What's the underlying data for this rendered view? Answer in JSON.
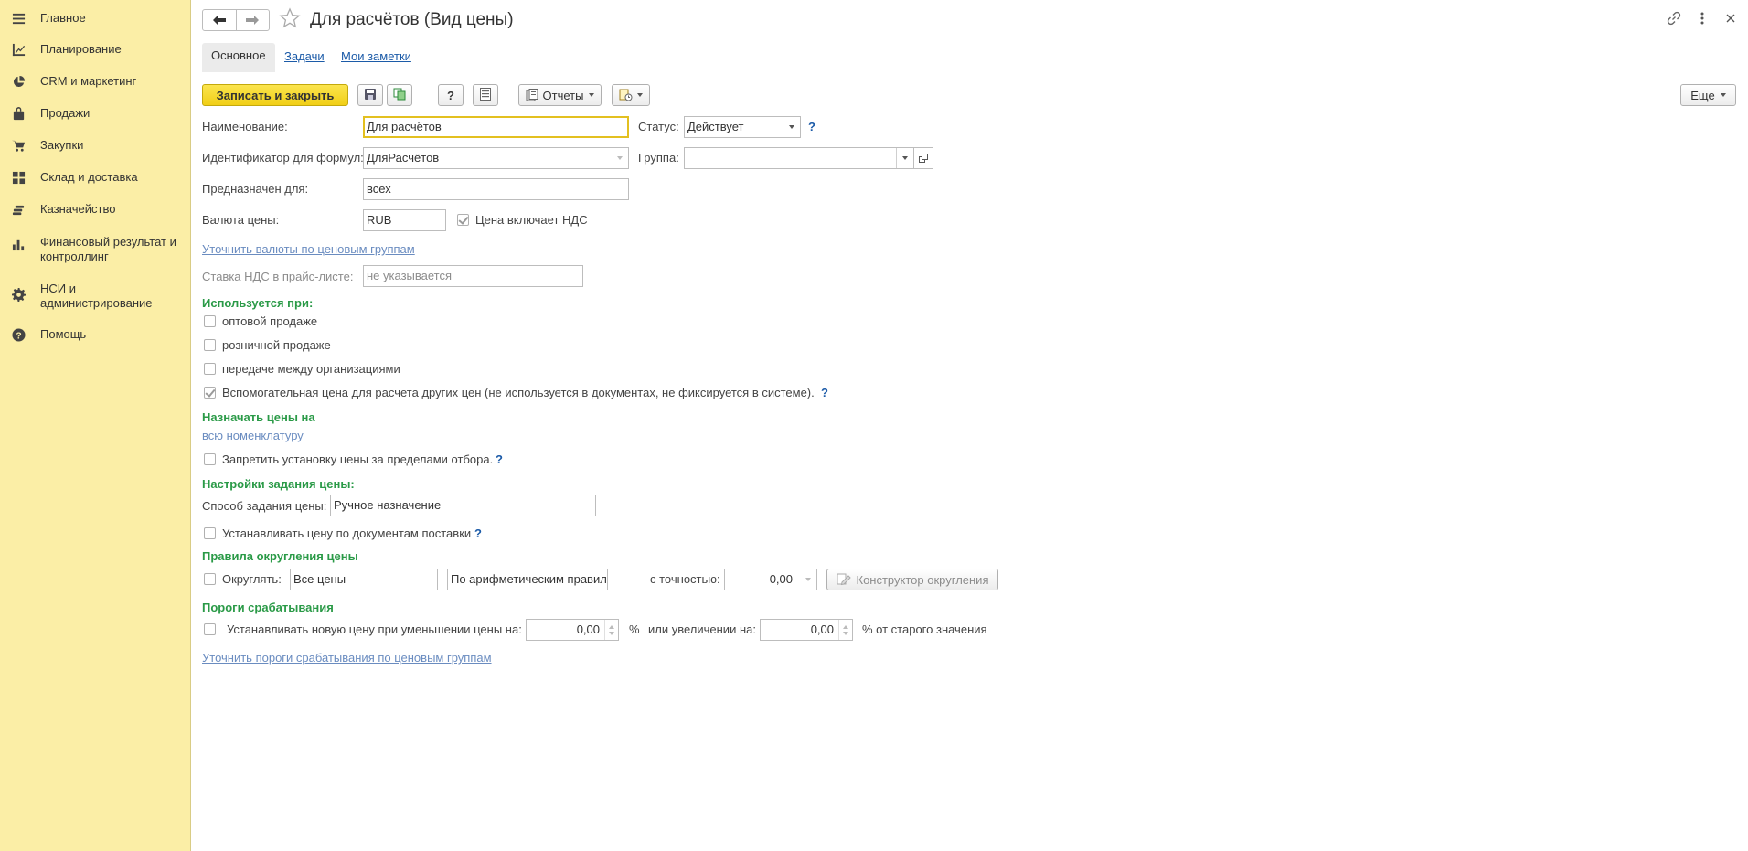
{
  "sidebar": {
    "items": [
      {
        "label": "Главное",
        "icon": "menu-icon"
      },
      {
        "label": "Планирование",
        "icon": "planning-icon"
      },
      {
        "label": "CRM и маркетинг",
        "icon": "pie-chart-icon"
      },
      {
        "label": "Продажи",
        "icon": "bag-icon"
      },
      {
        "label": "Закупки",
        "icon": "cart-icon"
      },
      {
        "label": "Склад и доставка",
        "icon": "warehouse-icon"
      },
      {
        "label": "Казначейство",
        "icon": "coins-icon"
      },
      {
        "label": "Финансовый результат и контроллинг",
        "icon": "bar-chart-icon"
      },
      {
        "label": "НСИ и администрирование",
        "icon": "gear-icon"
      },
      {
        "label": "Помощь",
        "icon": "help-icon"
      }
    ]
  },
  "header": {
    "title": "Для расчётов (Вид цены)"
  },
  "tabs": {
    "main": "Основное",
    "tasks": "Задачи",
    "notes": "Мои заметки"
  },
  "toolbar": {
    "save_close": "Записать и закрыть",
    "help": "?",
    "reports": "Отчеты",
    "more": "Еще"
  },
  "form": {
    "name_label": "Наименование:",
    "name_value": "Для расчётов",
    "status_label": "Статус:",
    "status_value": "Действует",
    "formula_id_label": "Идентификатор для формул:",
    "formula_id_value": "ДляРасчётов",
    "group_label": "Группа:",
    "group_value": "",
    "purpose_label": "Предназначен для:",
    "purpose_value": "всех",
    "currency_label": "Валюта цены:",
    "currency_value": "RUB",
    "vat_included_label": "Цена включает НДС",
    "currency_link": "Уточнить валюты по ценовым группам",
    "vat_rate_label": "Ставка НДС в прайс-листе:",
    "vat_rate_value": "не указывается",
    "used_in_title": "Используется при:",
    "wholesale": "оптовой продаже",
    "retail": "розничной продаже",
    "interorg": "передаче между организациями",
    "auxiliary": "Вспомогательная цена для расчета других цен (не используется в документах, не фиксируется в системе).",
    "assign_title": "Назначать цены на",
    "assign_link": "всю номенклатуру",
    "forbid_label": "Запретить установку цены за пределами отбора.",
    "settings_title": "Настройки задания цены:",
    "method_label": "Способ задания цены:",
    "method_value": "Ручное назначение",
    "set_by_docs": "Устанавливать цену по документам поставки",
    "rounding_title": "Правила округления цены",
    "round_label": "Округлять:",
    "round_prices": "Все цены",
    "round_rule": "По арифметическим правилам",
    "precision_label": "с точностью:",
    "precision_value": "0,00",
    "constructor_button": "Конструктор округления",
    "thresholds_title": "Пороги срабатывания",
    "threshold_label": "Устанавливать новую цену при уменьшении цены на:",
    "decrease_value": "0,00",
    "percent": "%",
    "increase_label": "или увеличении на:",
    "increase_value": "0,00",
    "old_value_label": "% от старого значения",
    "thresholds_link": "Уточнить пороги срабатывания по ценовым группам"
  }
}
